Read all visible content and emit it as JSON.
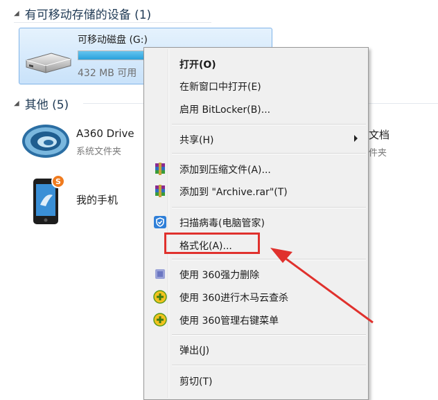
{
  "sections": {
    "removable": {
      "title": "有可移动存储的设备 (1)"
    },
    "other": {
      "title": "其他 (5)"
    }
  },
  "drive": {
    "name": "可移动磁盘 (G:)",
    "space_text": "432 MB 可用",
    "used_fraction": 0.95
  },
  "other_items": [
    {
      "title": "A360 Drive",
      "subtitle": "系统文件夹",
      "icon": "a360-drive-icon"
    },
    {
      "title": "我的手机",
      "icon": "phone-icon"
    },
    {
      "title": "文档",
      "subtitle": "件夹"
    }
  ],
  "context_menu": {
    "items": [
      {
        "label": "打开(O)",
        "bold": true
      },
      {
        "label": "在新窗口中打开(E)"
      },
      {
        "label": "启用 BitLocker(B)..."
      },
      {
        "label": "共享(H)",
        "submenu": true
      },
      {
        "label": "添加到压缩文件(A)...",
        "icon": "winrar-icon"
      },
      {
        "label": "添加到 \"Archive.rar\"(T)",
        "icon": "winrar-icon"
      },
      {
        "label": "扫描病毒(电脑管家)",
        "icon": "pc-manager-shield-icon"
      },
      {
        "label": "格式化(A)...",
        "highlighted": true
      },
      {
        "label": "使用 360强力删除",
        "icon": "360-delete-icon"
      },
      {
        "label": "使用 360进行木马云查杀",
        "icon": "360-plus-icon"
      },
      {
        "label": "使用 360管理右键菜单",
        "icon": "360-plus-icon"
      },
      {
        "label": "弹出(J)"
      },
      {
        "label": "剪切(T)"
      }
    ]
  },
  "colors": {
    "highlight_red": "#e0312d",
    "selection_blue": "#c9e2fa",
    "bar_fill": "#2aa0db"
  }
}
